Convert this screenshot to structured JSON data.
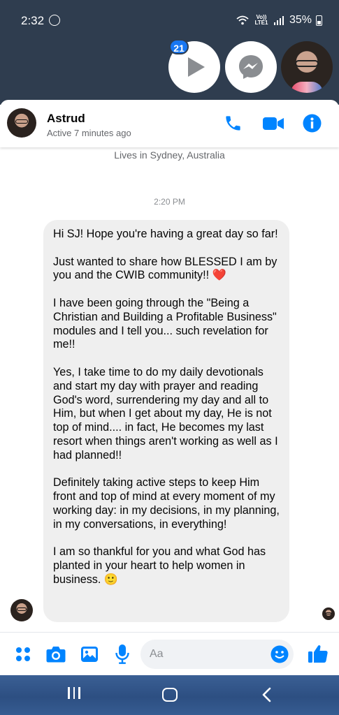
{
  "status_bar": {
    "time": "2:32",
    "network": "Vo)) LTE1",
    "battery": "35%"
  },
  "chat_heads": {
    "video_badge": "21"
  },
  "header": {
    "name": "Astrud",
    "status": "Active 7 minutes ago"
  },
  "profile_line": "Lives in Sydney, Australia",
  "timestamp": "2:20 PM",
  "message": {
    "paragraphs": [
      "Hi SJ! Hope you're having a great day so far!",
      "Just wanted to share how BLESSED I am by you and the CWIB community!! ❤️",
      "I have been going through the \"Being a Christian and Building a Profitable Business\" modules and I tell you... such revelation for me!!",
      "Yes, I take time to do my daily devotionals and start my day with prayer and reading God's word, surrendering my day and all to Him, but when I get about my day, He is not top of mind.... in fact, He becomes my last resort when things aren't working as well as I had planned!!",
      "Definitely taking active steps to keep Him front and top of mind at every moment of my working day: in my decisions, in my planning, in my conversations, in everything!",
      "I am so thankful for you and what God has planted in your heart to help women in business. 🙂"
    ]
  },
  "composer": {
    "placeholder": "Aa"
  },
  "colors": {
    "accent": "#0084ff",
    "bubble": "#efefef",
    "top_overlay": "#2f3d4f"
  }
}
